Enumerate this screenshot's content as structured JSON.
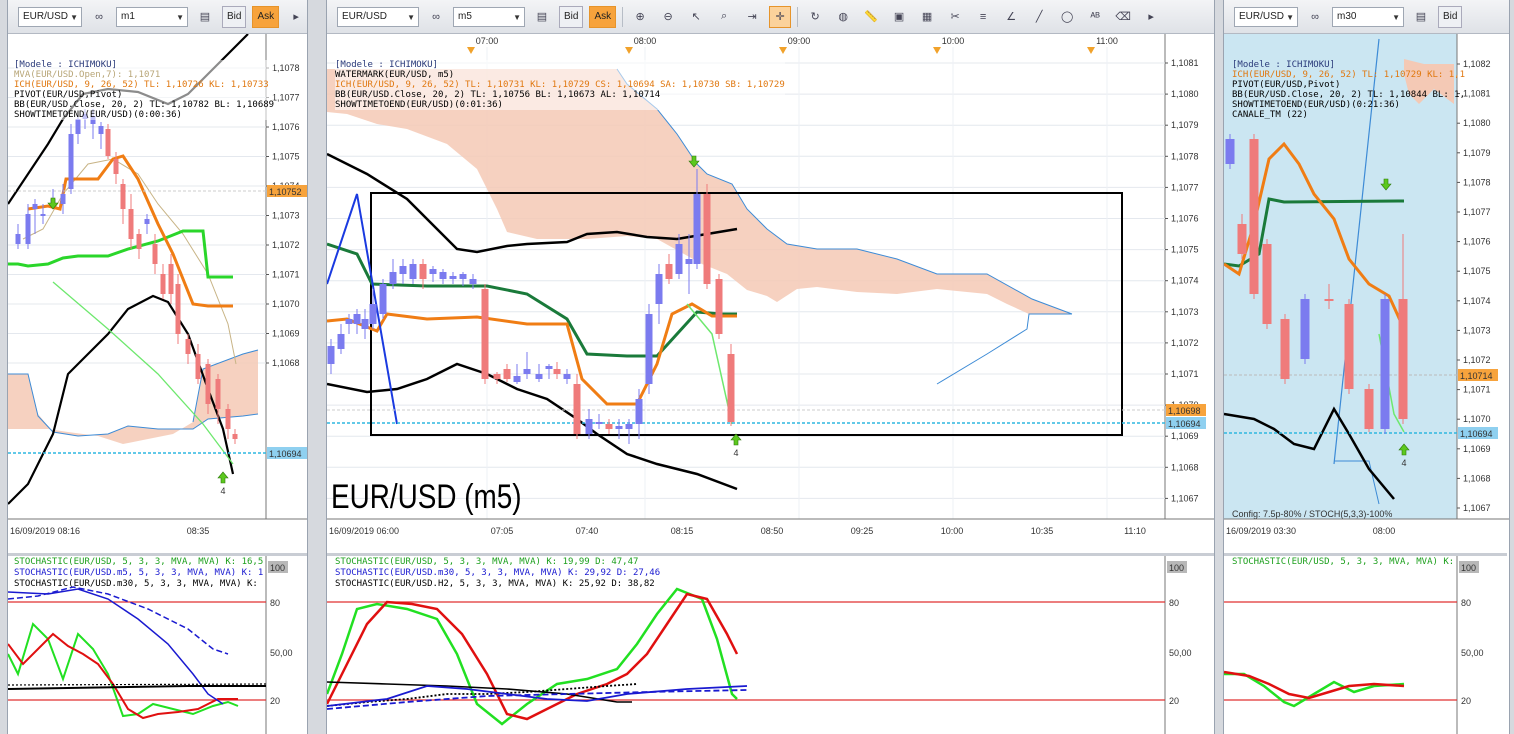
{
  "panels": [
    {
      "id": "m1",
      "symbol": "EUR/USD",
      "timeframe": "m1",
      "show_ask": true,
      "legend": [
        {
          "text": "[Modele : ICHIMOKU]",
          "color": "#2a3a7a"
        },
        {
          "text": "MVA(EUR/USD.Open,7): 1,1071",
          "color": "#b8a678"
        },
        {
          "text": "ICH(EUR/USD, 9, 26, 52)  TL: 1,10726  KL: 1,10733",
          "color": "#e07810"
        },
        {
          "text": "PIVOT(EUR/USD,Pivot)",
          "color": "#000000"
        },
        {
          "text": "BB(EUR/USD.Close, 20, 2)  TL: 1,10782  BL: 1,10689",
          "color": "#000000"
        },
        {
          "text": "SHOWTIMETOEND(EUR/USD)(0:00:36)",
          "color": "#000000"
        }
      ],
      "y_ticks": [
        "1,1078",
        "1,1077",
        "1,1076",
        "1,1075",
        "1,1074",
        "1,1073",
        "1,1072",
        "1,1071",
        "1,1070",
        "1,1069",
        "1,1068"
      ],
      "tags": [
        {
          "text": "1,10752",
          "bg": "#f7a33c"
        },
        {
          "text": "1,10694",
          "bg": "#8fd0f0"
        }
      ],
      "x_labels": [
        "16/09/2019 08:16",
        "08:35"
      ],
      "arrow_label": "4",
      "stoch_legend": [
        {
          "text": "STOCHASTIC(EUR/USD, 5, 3, 3, MVA, MVA)  K: 16,5",
          "color": "#1ea01e"
        },
        {
          "text": "STOCHASTIC(EUR/USD.m5, 5, 3, 3, MVA, MVA)  K: 1",
          "color": "#1a1ad0"
        },
        {
          "text": "STOCHASTIC(EUR/USD.m30, 5, 3, 3, MVA, MVA)  K:",
          "color": "#000000"
        }
      ],
      "stoch_ticks": [
        "100",
        "80",
        "50,00",
        "20"
      ]
    },
    {
      "id": "m5",
      "symbol": "EUR/USD",
      "timeframe": "m5",
      "show_ask": true,
      "top_times": [
        "07:00",
        "08:00",
        "09:00",
        "10:00",
        "11:00"
      ],
      "legend": [
        {
          "text": "[Modele : ICHIMOKU]",
          "color": "#2a3a7a"
        },
        {
          "text": "WATERMARK(EUR/USD, m5)",
          "color": "#000000"
        },
        {
          "text": "ICH(EUR/USD, 9, 26, 52)  TL: 1,10731  KL: 1,10729  CS: 1,10694  SA: 1,10730  SB: 1,10729",
          "color": "#e07810"
        },
        {
          "text": "BB(EUR/USD.Close, 20, 2)  TL: 1,10756  BL: 1,10673  AL: 1,10714",
          "color": "#000000"
        },
        {
          "text": "SHOWTIMETOEND(EUR/USD)(0:01:36)",
          "color": "#000000"
        }
      ],
      "watermark": "EUR/USD (m5)",
      "y_ticks": [
        "1,1081",
        "1,1080",
        "1,1079",
        "1,1078",
        "1,1077",
        "1,1076",
        "1,1075",
        "1,1074",
        "1,1073",
        "1,1072",
        "1,1071",
        "1,1070",
        "1,1069",
        "1,1068",
        "1,1067"
      ],
      "tags": [
        {
          "text": "1,10698",
          "bg": "#f7a33c"
        },
        {
          "text": "1,10694",
          "bg": "#8fd0f0"
        }
      ],
      "x_labels": [
        "16/09/2019 06:00",
        "07:05",
        "07:40",
        "08:15",
        "08:50",
        "09:25",
        "10:00",
        "10:35",
        "11:10"
      ],
      "arrow_label": "4",
      "stoch_legend": [
        {
          "text": "STOCHASTIC(EUR/USD, 5, 3, 3, MVA, MVA)  K: 19,99  D: 47,47",
          "color": "#1ea01e"
        },
        {
          "text": "STOCHASTIC(EUR/USD.m30, 5, 3, 3, MVA, MVA)  K: 29,92  D: 27,46",
          "color": "#1a1ad0"
        },
        {
          "text": "STOCHASTIC(EUR/USD.H2, 5, 3, 3, MVA, MVA)  K: 25,92  D: 38,82",
          "color": "#000000"
        }
      ],
      "stoch_ticks": [
        "100",
        "80",
        "50,00",
        "20"
      ]
    },
    {
      "id": "m30",
      "symbol": "EUR/USD",
      "timeframe": "m30",
      "show_ask": false,
      "legend": [
        {
          "text": "[Modele : ICHIMOKU]",
          "color": "#2a3a7a"
        },
        {
          "text": "ICH(EUR/USD, 9, 26, 52)  TL: 1,10729  KL: 1,1",
          "color": "#e07810"
        },
        {
          "text": "PIVOT(EUR/USD,Pivot)",
          "color": "#000000"
        },
        {
          "text": "BB(EUR/USD.Close, 20, 2)  TL: 1,10844  BL: 1,",
          "color": "#000000"
        },
        {
          "text": "SHOWTIMETOEND(EUR/USD)(0:21:36)",
          "color": "#000000"
        },
        {
          "text": "CANALE_TM (22)",
          "color": "#000000"
        }
      ],
      "config_text": "Config: 7.5p-80% / STOCH(5,3,3)-100%",
      "y_ticks": [
        "1,1082",
        "1,1081",
        "1,1080",
        "1,1079",
        "1,1078",
        "1,1077",
        "1,1076",
        "1,1075",
        "1,1074",
        "1,1073",
        "1,1072",
        "1,1071",
        "1,1070",
        "1,1069",
        "1,1068",
        "1,1067"
      ],
      "tags": [
        {
          "text": "1,10714",
          "bg": "#f7a33c"
        },
        {
          "text": "1,10694",
          "bg": "#8fd0f0"
        }
      ],
      "x_labels": [
        "16/09/2019 03:30",
        "08:00"
      ],
      "arrow_label": "4",
      "stoch_legend": [
        {
          "text": "STOCHASTIC(EUR/USD, 5, 3, 3, MVA, MVA)  K:",
          "color": "#1ea01e"
        }
      ],
      "stoch_ticks": [
        "100",
        "80",
        "50,00",
        "20"
      ]
    }
  ],
  "toolbar": {
    "bid_label": "Bid",
    "ask_label": "Ask"
  },
  "colors": {
    "up_candle": "#7b7bef",
    "down_candle": "#ef7b7b",
    "kumo_fill": "#f4c9b5",
    "kumo_line": "#3d8bd6",
    "tenkan": "#f07d14",
    "kijun": "#2ad62a",
    "kijun_m5": "#1a7a3a",
    "bollinger": "#000000",
    "stoch_k": "#22e022",
    "stoch_d": "#e01010",
    "stoch_level": "#e03030",
    "ask_line": "#2fb7e0"
  }
}
